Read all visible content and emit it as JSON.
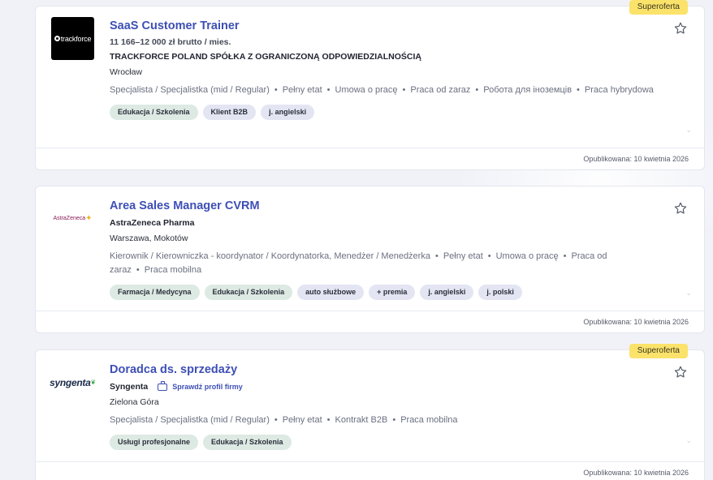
{
  "badge_label": "Superoferta",
  "cards": [
    {
      "title": "SaaS Customer Trainer",
      "salary": "11 166–12 000 zł brutto / mies.",
      "company": "TRACKFORCE POLAND SPÓŁKA Z OGRANICZONĄ ODPOWIEDZIALNOŚCIĄ",
      "location": "Wrocław",
      "details": [
        "Specjalista / Specjalistka (mid / Regular)",
        "Pełny etat",
        "Umowa o pracę",
        "Praca od zaraz",
        "Робота для іноземців",
        "Praca hybrydowa"
      ],
      "chips": [
        "Edukacja / Szkolenia",
        "Klient B2B",
        "j. angielski"
      ],
      "published": "Opublikowana: 10 kwietnia 2026",
      "logo_text": "trackforce",
      "superoferta": true
    },
    {
      "title": "Area Sales Manager CVRM",
      "company": "AstraZeneca Pharma",
      "location": "Warszawa, Mokotów",
      "details": [
        "Kierownik / Kierowniczka - koordynator / Koordynatorka, Menedżer / Menedżerka",
        "Pełny etat",
        "Umowa o pracę",
        "Praca od zaraz",
        "Praca mobilna"
      ],
      "chips": [
        "Farmacja / Medycyna",
        "Edukacja / Szkolenia",
        "auto służbowe",
        "+ premia",
        "j. angielski",
        "j. polski"
      ],
      "published": "Opublikowana: 10 kwietnia 2026",
      "logo_text": "AstraZeneca",
      "superoferta": false
    },
    {
      "title": "Doradca ds. sprzedaży",
      "company": "Syngenta",
      "profile_link": "Sprawdź profil firmy",
      "location": "Zielona Góra",
      "details": [
        "Specjalista / Specjalistka (mid / Regular)",
        "Pełny etat",
        "Kontrakt B2B",
        "Praca mobilna"
      ],
      "chips": [
        "Usługi profesjonalne",
        "Edukacja / Szkolenia"
      ],
      "published": "Opublikowana: 10 kwietnia 2026",
      "logo_text": "syngenta",
      "superoferta": true
    }
  ],
  "colors": {
    "accent": "#3d4fb5",
    "badge": "#fbe26a",
    "chip_green": "#dde9e3",
    "chip_purple": "#e3e5f3"
  }
}
